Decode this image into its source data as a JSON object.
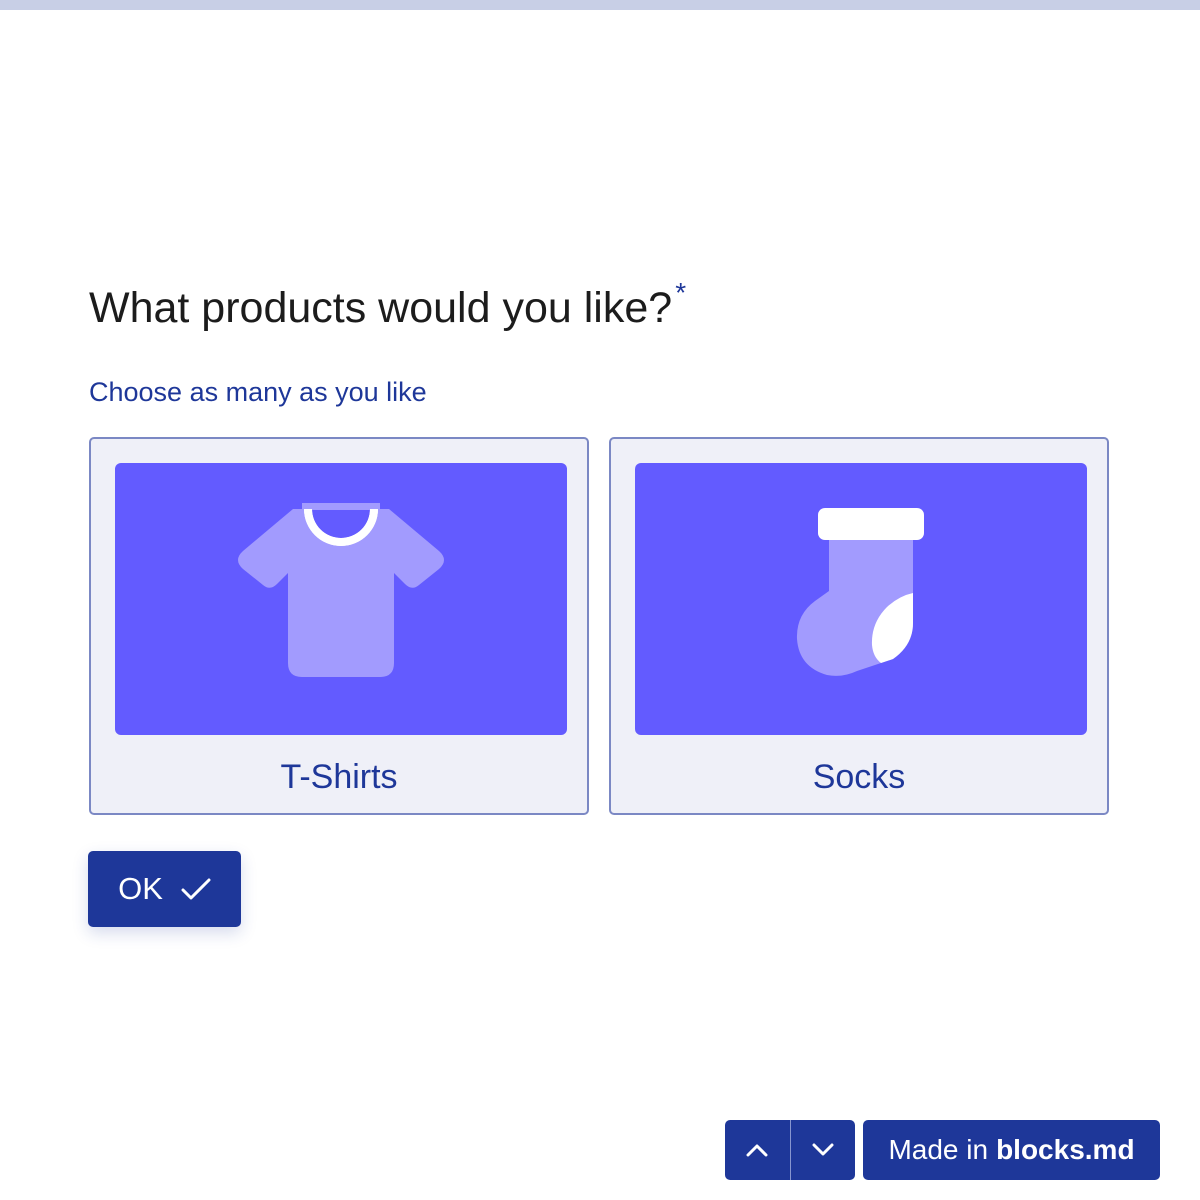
{
  "progress": {
    "fraction": 0
  },
  "question": {
    "title": "What products would you like?",
    "required_mark": "*",
    "hint": "Choose as many as you like"
  },
  "choices": [
    {
      "label": "T-Shirts",
      "icon": "t-shirt-icon"
    },
    {
      "label": "Socks",
      "icon": "sock-icon"
    }
  ],
  "ok_button": {
    "label": "OK",
    "icon": "checkmark-icon"
  },
  "navigation": {
    "up_icon": "chevron-up-icon",
    "down_icon": "chevron-down-icon"
  },
  "branding": {
    "prefix": "Made in",
    "brand": "blocks.md"
  },
  "colors": {
    "accent": "#1e3799",
    "card_image_bg": "#635bff",
    "icon_fill": "#a29bfe",
    "card_bg": "#eff0f8",
    "card_border": "#7b88c4",
    "progress_track": "#c8cfe6"
  }
}
